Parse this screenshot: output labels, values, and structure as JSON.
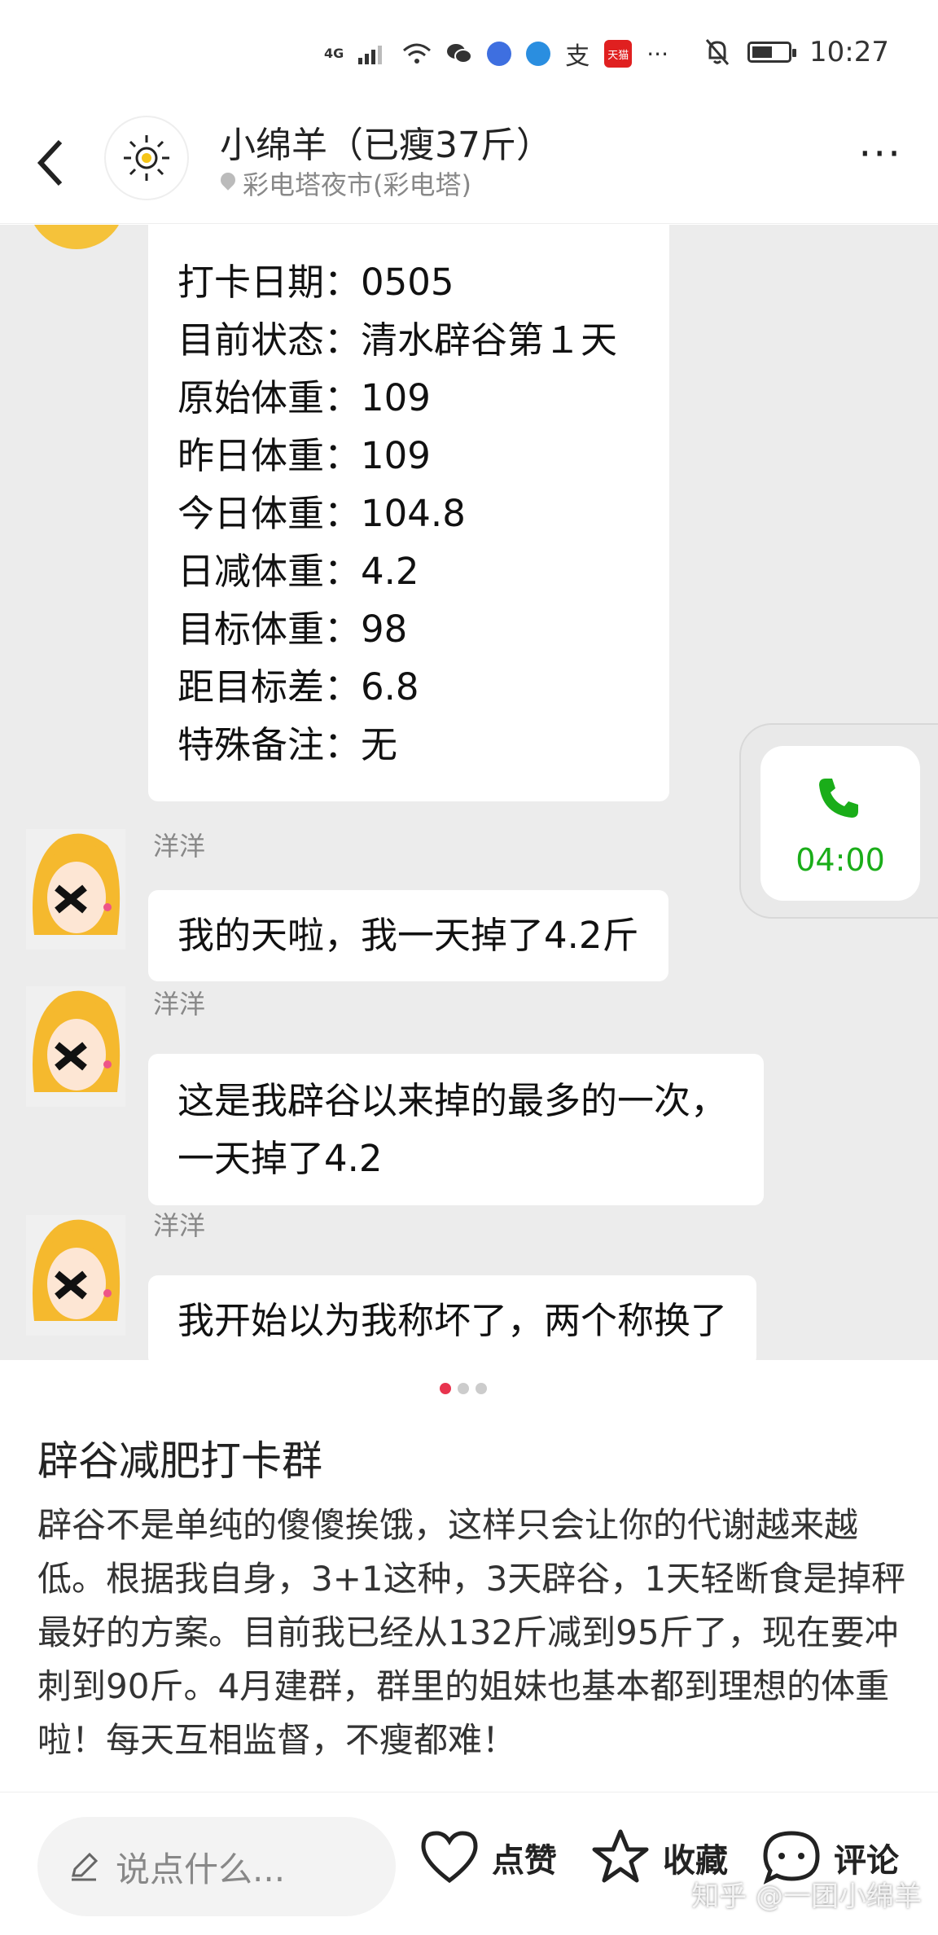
{
  "status_bar": {
    "network": "4G",
    "time": "10:27",
    "tmall_label": "天猫",
    "alipay_label": "支",
    "overflow": "···"
  },
  "header": {
    "back_icon": "back-chevron-icon",
    "title": "小绵羊（已瘦37斤）",
    "location": "彩电塔夜市(彩电塔)",
    "more_label": "···"
  },
  "chat": {
    "checkin_rows": [
      "打卡日期：0505",
      "目前状态：清水辟谷第１天",
      "原始体重：109",
      "昨日体重：109",
      "今日体重：104.8",
      "日减体重：4.2",
      "目标体重：98",
      "距目标差：6.8",
      "特殊备注：无"
    ],
    "messages": [
      {
        "sender": "洋洋",
        "lines": [
          "我的天啦，我一天掉了4.2斤"
        ]
      },
      {
        "sender": "洋洋",
        "lines": [
          "这是我辟谷以来掉的最多的一次，",
          "一天掉了4.2"
        ]
      },
      {
        "sender": "洋洋",
        "lines": [
          "我开始以为我称坏了，两个称换了"
        ]
      }
    ],
    "call_card": {
      "time": "04:00"
    }
  },
  "carousel": {
    "count": 3,
    "active": 0
  },
  "post": {
    "title": "辟谷减肥打卡群",
    "body": "辟谷不是单纯的傻傻挨饿，这样只会让你的代谢越来越低。根据我自身，3+1这种，3天辟谷，1天轻断食是掉秤最好的方案。目前我已经从132斤减到95斤了，现在要冲刺到90斤。4月建群，群里的姐妹也基本都到理想的体重啦！每天互相监督，不瘦都难！"
  },
  "bottom_bar": {
    "comment_placeholder": "说点什么...",
    "like_label": "点赞",
    "favorite_label": "收藏",
    "comment_label": "评论",
    "watermark": "知乎 @一团小绵羊"
  },
  "colors": {
    "accent_green": "#1aad19",
    "active_dot": "#e8344e",
    "chat_bg": "#ececec"
  }
}
